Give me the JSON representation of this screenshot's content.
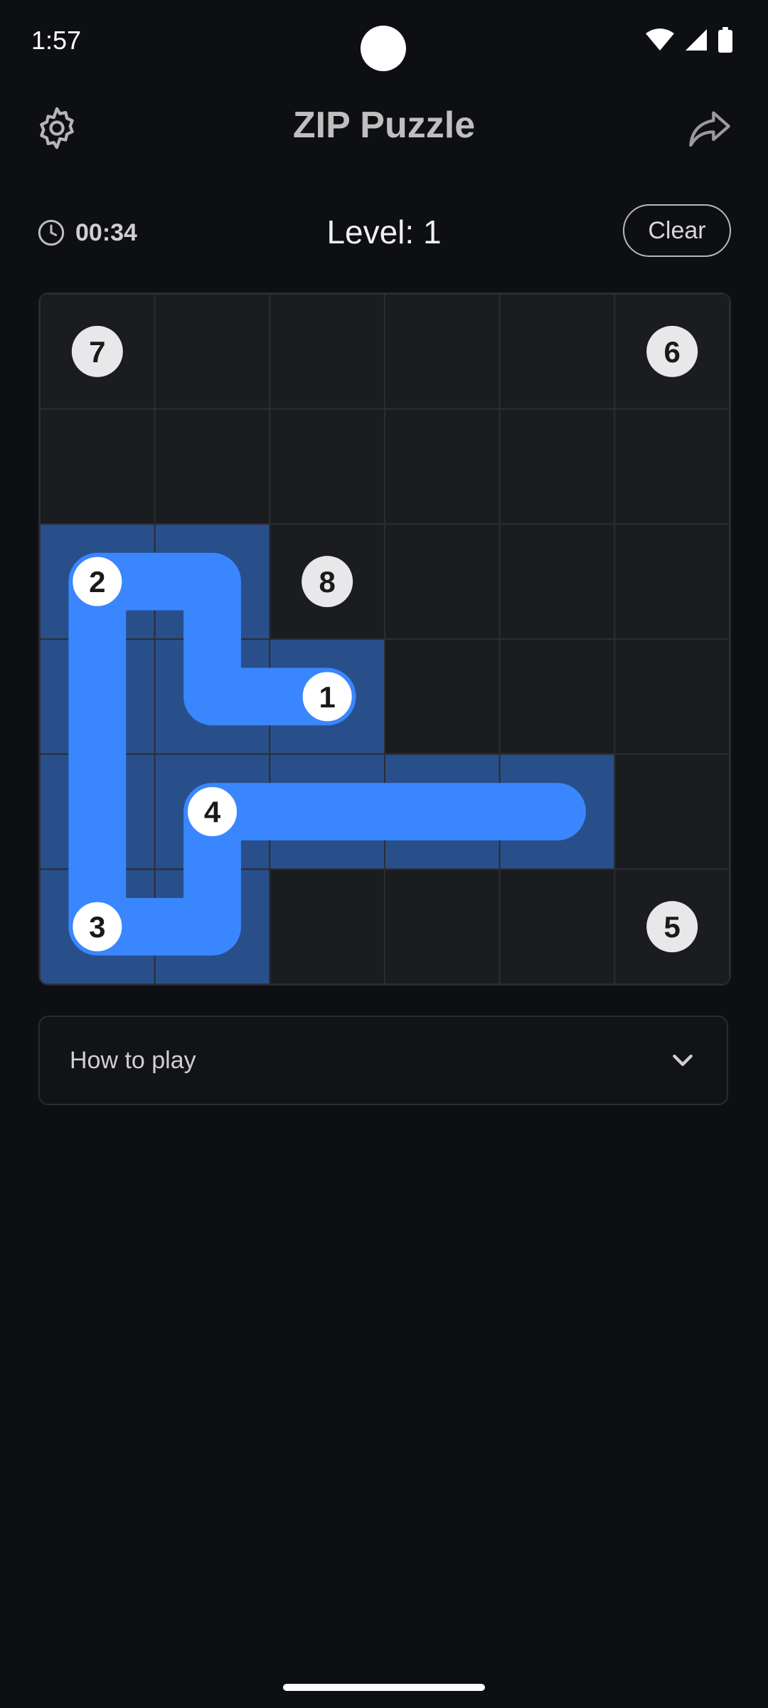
{
  "status": {
    "time": "1:57"
  },
  "header": {
    "title": "ZIP Puzzle"
  },
  "info": {
    "timer": "00:34",
    "level": "Level: 1",
    "clear_label": "Clear"
  },
  "colors": {
    "path": "#3a86ff",
    "path_shade": "#284f8a",
    "cell": "#1b1c20",
    "grid_line": "#2c2d33",
    "badge": "#e8e8ea"
  },
  "board": {
    "rows": 6,
    "cols": 6,
    "numbers": [
      {
        "label": "7",
        "row": 0,
        "col": 0,
        "on_path": false
      },
      {
        "label": "6",
        "row": 0,
        "col": 5,
        "on_path": false
      },
      {
        "label": "2",
        "row": 2,
        "col": 0,
        "on_path": true
      },
      {
        "label": "8",
        "row": 2,
        "col": 2,
        "on_path": false
      },
      {
        "label": "1",
        "row": 3,
        "col": 2,
        "on_path": true
      },
      {
        "label": "4",
        "row": 4,
        "col": 1,
        "on_path": true
      },
      {
        "label": "3",
        "row": 5,
        "col": 0,
        "on_path": true
      },
      {
        "label": "5",
        "row": 5,
        "col": 5,
        "on_path": false
      }
    ],
    "path": [
      [
        3,
        2
      ],
      [
        3,
        1
      ],
      [
        2,
        1
      ],
      [
        2,
        0
      ],
      [
        3,
        0
      ],
      [
        4,
        0
      ],
      [
        5,
        0
      ],
      [
        5,
        1
      ],
      [
        4,
        1
      ],
      [
        4,
        2
      ],
      [
        4,
        3
      ],
      [
        4,
        4
      ]
    ]
  },
  "how_to_play": {
    "label": "How to play"
  }
}
